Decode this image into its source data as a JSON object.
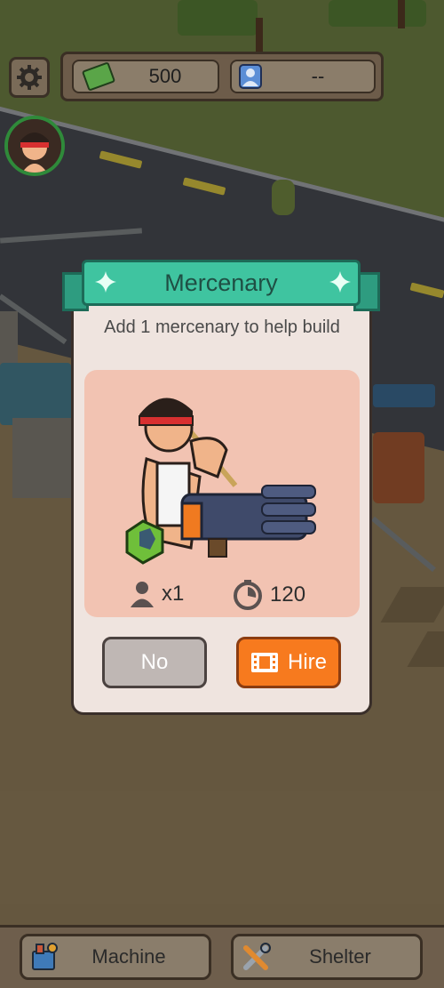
{
  "hud": {
    "cash": "500",
    "population": "--"
  },
  "modal": {
    "title": "Mercenary",
    "description": "Add 1 mercenary to help build",
    "count": "x1",
    "time": "120",
    "no_label": "No",
    "hire_label": "Hire"
  },
  "bottom_bar": {
    "machine_label": "Machine",
    "shelter_label": "Shelter"
  },
  "colors": {
    "ribbon": "#3fc4a0",
    "hire_button": "#f77a1e",
    "no_button": "#bfb7b4",
    "panel": "#f2c3b2"
  },
  "icons": [
    "gear-icon",
    "cash-icon",
    "user-icon",
    "person-icon",
    "timer-icon",
    "film-icon",
    "machine-icon",
    "tools-icon",
    "sparkle-icon"
  ]
}
